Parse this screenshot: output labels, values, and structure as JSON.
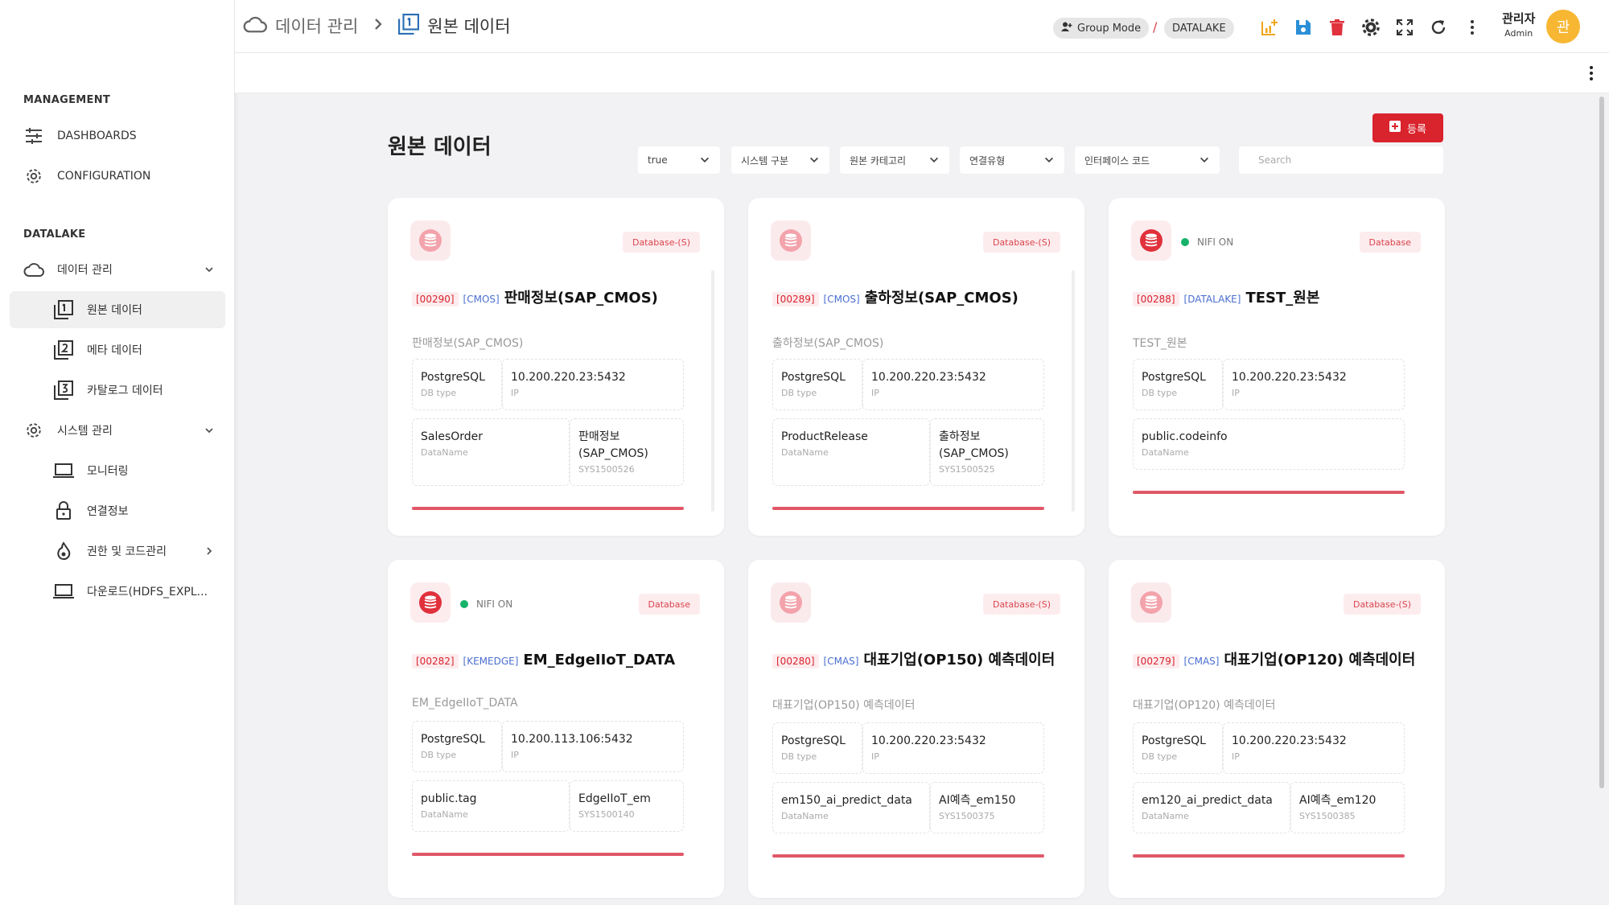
{
  "sidebar": {
    "section_management": "MANAGEMENT",
    "section_datalake": "DATALAKE",
    "items": {
      "dashboards": "DASHBOARDS",
      "configuration": "CONFIGURATION",
      "data_mgmt": "데이터 관리",
      "raw_data": "원본 데이터",
      "meta_data": "메타 데이터",
      "catalog_data": "카탈로그 데이터",
      "system_mgmt": "시스템 관리",
      "monitoring": "모니터링",
      "connection": "연결정보",
      "auth_code": "권한 및 코드관리",
      "download": "다운로드(HDFS_EXPL..."
    }
  },
  "header": {
    "crumb_parent": "데이터 관리",
    "crumb_current": "원본 데이터",
    "group_mode": "Group Mode",
    "slash": "/",
    "datalake": "DATALAKE",
    "user_name": "관리자",
    "user_role": "Admin",
    "avatar_letter": "관"
  },
  "main": {
    "title": "원본 데이터",
    "register_label": "등록",
    "filters": [
      "true",
      "시스템 구분",
      "원본 카테고리",
      "연결유형",
      "인터페이스 코드"
    ],
    "search_placeholder": "Search"
  },
  "cards": [
    {
      "badge": "Database-(S)",
      "nifi": "",
      "code": "[00290]",
      "sys": "[CMOS]",
      "name": "판매정보(SAP_CMOS)",
      "desc": "판매정보(SAP_CMOS)",
      "db_type": "PostgreSQL",
      "db_type_label": "DB type",
      "ip": "10.200.220.23:5432",
      "ip_label": "IP",
      "data_name": "SalesOrder",
      "data_name_label": "DataName",
      "sys_name": "판매정보\n(SAP_CMOS)",
      "sys_id": "SYS1500526"
    },
    {
      "badge": "Database-(S)",
      "nifi": "",
      "code": "[00289]",
      "sys": "[CMOS]",
      "name": "출하정보(SAP_CMOS)",
      "desc": "출하정보(SAP_CMOS)",
      "db_type": "PostgreSQL",
      "db_type_label": "DB type",
      "ip": "10.200.220.23:5432",
      "ip_label": "IP",
      "data_name": "ProductRelease",
      "data_name_label": "DataName",
      "sys_name": "출하정보\n(SAP_CMOS)",
      "sys_id": "SYS1500525"
    },
    {
      "badge": "Database",
      "nifi": "NIFI ON",
      "code": "[00288]",
      "sys": "[DATALAKE]",
      "name": "TEST_원본",
      "desc": "TEST_원본",
      "db_type": "PostgreSQL",
      "db_type_label": "DB type",
      "ip": "10.200.220.23:5432",
      "ip_label": "IP",
      "data_name": "public.codeinfo",
      "data_name_label": "DataName",
      "sys_name": "",
      "sys_id": ""
    },
    {
      "badge": "Database",
      "nifi": "NIFI ON",
      "code": "[00282]",
      "sys": "[KEMEDGE]",
      "name": "EM_EdgeIIoT_DATA",
      "desc": "EM_EdgeIIoT_DATA",
      "db_type": "PostgreSQL",
      "db_type_label": "DB type",
      "ip": "10.200.113.106:5432",
      "ip_label": "IP",
      "data_name": "public.tag",
      "data_name_label": "DataName",
      "sys_name": "EdgeIIoT_em",
      "sys_id": "SYS1500140"
    },
    {
      "badge": "Database-(S)",
      "nifi": "",
      "code": "[00280]",
      "sys": "[CMAS]",
      "name": "대표기업(OP150) 예측데이터",
      "desc": "대표기업(OP150) 예측데이터",
      "db_type": "PostgreSQL",
      "db_type_label": "DB type",
      "ip": "10.200.220.23:5432",
      "ip_label": "IP",
      "data_name": "em150_ai_predict_data",
      "data_name_label": "DataName",
      "sys_name": "AI예측_em150",
      "sys_id": "SYS1500375"
    },
    {
      "badge": "Database-(S)",
      "nifi": "",
      "code": "[00279]",
      "sys": "[CMAS]",
      "name": "대표기업(OP120) 예측데이터",
      "desc": "대표기업(OP120) 예측데이터",
      "db_type": "PostgreSQL",
      "db_type_label": "DB type",
      "ip": "10.200.220.23:5432",
      "ip_label": "IP",
      "data_name": "em120_ai_predict_data",
      "data_name_label": "DataName",
      "sys_name": "AI예측_em120",
      "sys_id": "SYS1500385"
    }
  ],
  "colors": {
    "accent_red": "#d9232d",
    "nifi_green": "#17b26a",
    "avatar": "#f7b733",
    "link_blue": "#4a6fd1"
  }
}
